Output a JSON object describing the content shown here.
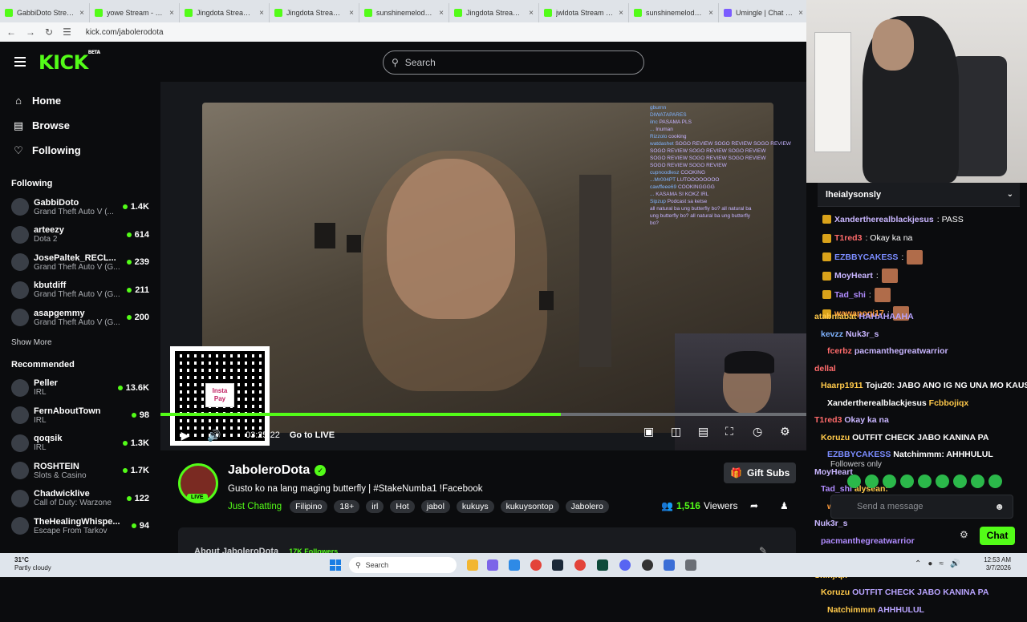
{
  "browser": {
    "tabs": [
      {
        "title": "GabbiDoto Stream - ",
        "fav": "kick"
      },
      {
        "title": "yowe Stream - Watc",
        "fav": "kick"
      },
      {
        "title": "Jingdota Stream - W",
        "fav": "kick"
      },
      {
        "title": "Jingdota Stream - W",
        "fav": "kick"
      },
      {
        "title": "sunshinemelodyyy S",
        "fav": "kick"
      },
      {
        "title": "Jingdota Stream - W",
        "fav": "kick"
      },
      {
        "title": "jwldota Stream - Wa",
        "fav": "kick"
      },
      {
        "title": "sunshinemelodyyy S",
        "fav": "kick"
      },
      {
        "title": "Umingle | Chat with",
        "fav": "purple"
      }
    ],
    "url": "kick.com/jabolerodota"
  },
  "header": {
    "logo": "KICK",
    "logo_sup": "BETA",
    "search_placeholder": "Search"
  },
  "sidebar": {
    "nav": [
      {
        "label": "Home",
        "icon": "home-icon"
      },
      {
        "label": "Browse",
        "icon": "browse-icon"
      },
      {
        "label": "Following",
        "icon": "heart-icon"
      }
    ],
    "following_title": "Following",
    "following": [
      {
        "name": "GabbiDoto",
        "game": "Grand Theft Auto V (...",
        "viewers": "1.4K"
      },
      {
        "name": "arteezy",
        "game": "Dota 2",
        "viewers": "614"
      },
      {
        "name": "JosePaltek_RECL...",
        "game": "Grand Theft Auto V (G...",
        "viewers": "239"
      },
      {
        "name": "kbutdiff",
        "game": "Grand Theft Auto V (G...",
        "viewers": "211"
      },
      {
        "name": "asapgemmy",
        "game": "Grand Theft Auto V (G...",
        "viewers": "200"
      }
    ],
    "show_more": "Show More",
    "recommended_title": "Recommended",
    "recommended": [
      {
        "name": "Peller",
        "game": "IRL",
        "viewers": "13.6K"
      },
      {
        "name": "FernAboutTown",
        "game": "IRL",
        "viewers": "98"
      },
      {
        "name": "qoqsik",
        "game": "IRL",
        "viewers": "1.3K"
      },
      {
        "name": "ROSHTEIN",
        "game": "Slots & Casino",
        "viewers": "1.7K"
      },
      {
        "name": "Chadwicklive",
        "game": "Call of Duty: Warzone",
        "viewers": "122"
      },
      {
        "name": "TheHealingWhispe...",
        "game": "Escape From Tarkov",
        "viewers": "94"
      }
    ]
  },
  "player": {
    "time": "03:25:22",
    "go_live": "Go to LIVE",
    "progress": 0.62,
    "qr_badge": "Insta Pay",
    "overlay_chat": [
      {
        "u": "gburnn",
        "m": ""
      },
      {
        "u": "DIWATAPARES",
        "m": ""
      },
      {
        "u": "ilnc",
        "m": "PASAMA PLS"
      },
      {
        "u": "...",
        "m": "Inuman"
      },
      {
        "u": "Rizzolo",
        "m": "cooking"
      },
      {
        "u": "watdashet",
        "m": "SOGO REVIEW SOGO REVIEW SOGO REVIEW"
      },
      {
        "u": "",
        "m": "SOGO REVIEW SOGO REVIEW SOGO REVIEW"
      },
      {
        "u": "",
        "m": "SOGO REVIEW SOGO REVIEW SOGO REVIEW"
      },
      {
        "u": "",
        "m": "SOGO REVIEW SOGO REVIEW"
      },
      {
        "u": "cupnoodlesz",
        "m": "COOKING"
      },
      {
        "u": "...Mr004PT",
        "m": "LUTOOOOOOOO"
      },
      {
        "u": "cawffeee69",
        "m": "COOKINGGGG"
      },
      {
        "u": "...",
        "m": "KASAMA SI KOKZ IRL"
      },
      {
        "u": "Sipzup",
        "m": "Podcast sa ketse"
      },
      {
        "u": "",
        "m": "all natural ba ung butterfly bo? all natural ba"
      },
      {
        "u": "",
        "m": "ung butterfly bo? all natural ba ung butterfly"
      },
      {
        "u": "",
        "m": "bo?"
      }
    ]
  },
  "stream": {
    "name": "JaboleroDota",
    "live_badge": "LIVE",
    "title": "Gusto ko na lang maging butterfly | #StakeNumba1 !Facebook",
    "category": "Just Chatting",
    "tags": [
      "Filipino",
      "18+",
      "irl",
      "Hot",
      "jabol",
      "kukuys",
      "kukuysontop",
      "Jabolero"
    ],
    "gift_subs": "Gift Subs",
    "viewers": "1,516",
    "viewers_label": "Viewers",
    "about": "About JaboleroDota",
    "followers": "17K Followers"
  },
  "chat": {
    "pinned_user": "lheialysonsly",
    "messages": [
      {
        "user": "Xanderthereal​blackjesus",
        "text": ": PASS",
        "color": "#c9b6ff"
      },
      {
        "user": "T1red3",
        "text": ": Okay ka na",
        "color": "#ff6b6b"
      },
      {
        "user": "EZBBYCAKESS",
        "text": ":",
        "color": "#7b8cff",
        "emote": true
      },
      {
        "user": "MoyHeart",
        "text": ":",
        "color": "#c9b6ff",
        "emote": true
      },
      {
        "user": "Tad_shi",
        "text": ":",
        "color": "#b18cff",
        "emote": true
      },
      {
        "user": "wawapogi17",
        "text": ":",
        "color": "#ff9b3b",
        "emote": true
      }
    ],
    "overlay": [
      {
        "user": "atabnlabat",
        "text": "HAHAHAAHA",
        "uc": "#ffc94a",
        "tc": "#b9a4ff"
      },
      {
        "user": "kevzz",
        "text": "Nuk3r_s",
        "uc": "#7fb3ff",
        "tc": "#c9b6ff"
      },
      {
        "user": "fcerbz",
        "text": "pacmanthegreatwarrior",
        "uc": "#ff6b6b",
        "tc": "#c9b6ff"
      },
      {
        "user": "dellal",
        "text": "",
        "uc": "#ff6b6b",
        "tc": "#fff"
      },
      {
        "user": "Haarp1911",
        "text": "Toju20: JABO ANO IG NG UNA MO KAUSAP",
        "uc": "#ffc94a",
        "tc": "#fff"
      },
      {
        "user": "Xanderthereal​blackjesus",
        "text": "Fcbbojiqx",
        "uc": "#fff",
        "tc": "#ffc94a"
      },
      {
        "user": "T1red3",
        "text": "Okay ka na",
        "uc": "#ff6b6b",
        "tc": "#c9b6ff"
      },
      {
        "user": "Koruzu",
        "text": "OUTFIT CHECK JABO KANINA PA",
        "uc": "#ffc94a",
        "tc": "#fff"
      },
      {
        "user": "EZBBYCAKESS",
        "text": "Natchimmm: AHHHULUL",
        "uc": "#7b8cff",
        "tc": "#fff"
      },
      {
        "user": "MoyHeart",
        "text": "",
        "uc": "#c9b6ff",
        "tc": "#fff"
      },
      {
        "user": "Tad_shi",
        "text": "alysean:",
        "uc": "#b18cff",
        "tc": "#ffc94a"
      },
      {
        "user": "wawapogi17",
        "text": "",
        "uc": "#ff9b3b",
        "tc": "#fff"
      },
      {
        "user": "Nuk3r_s",
        "text": "",
        "uc": "#c9b6ff",
        "tc": "#fff"
      },
      {
        "user": "pacmanthegreatwarrior",
        "text": "",
        "uc": "#b18cff",
        "tc": "#fff"
      },
      {
        "user": "Toju20",
        "text": "JABO ANO IG NG UNA MO KAUSAP",
        "uc": "#fff",
        "tc": "#b9a4ff"
      },
      {
        "user": "Shinjiqx",
        "text": "",
        "uc": "#ffc94a",
        "tc": "#fff"
      },
      {
        "user": "Koruzu",
        "text": "OUTFIT CHECK JABO KANINA PA",
        "uc": "#ffc94a",
        "tc": "#b9a4ff"
      },
      {
        "user": "Natchimmm",
        "text": "AHHHULUL",
        "uc": "#ffc94a",
        "tc": "#b9a4ff"
      }
    ],
    "followers_only": "Followers only",
    "placeholder": "Send a message",
    "chat_button": "Chat"
  },
  "taskbar": {
    "temp": "31°C",
    "weather": "Partly cloudy",
    "search": "Search",
    "time": "12:53 AM",
    "date": "3/7/2026"
  },
  "colors": {
    "accent": "#53fc18",
    "bg": "#0b0c0e"
  }
}
